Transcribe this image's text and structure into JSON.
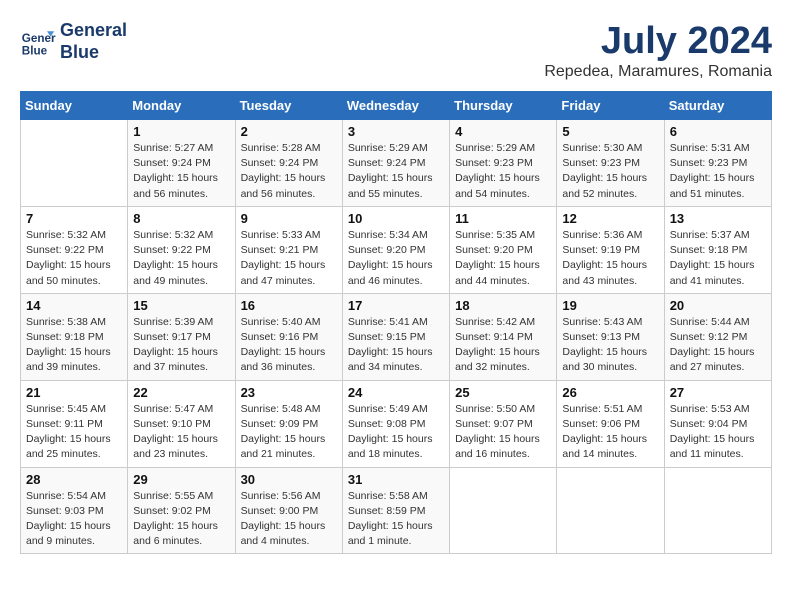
{
  "logo": {
    "line1": "General",
    "line2": "Blue"
  },
  "title": "July 2024",
  "location": "Repedea, Maramures, Romania",
  "days_header": [
    "Sunday",
    "Monday",
    "Tuesday",
    "Wednesday",
    "Thursday",
    "Friday",
    "Saturday"
  ],
  "weeks": [
    [
      {
        "day": "",
        "info": ""
      },
      {
        "day": "1",
        "info": "Sunrise: 5:27 AM\nSunset: 9:24 PM\nDaylight: 15 hours\nand 56 minutes."
      },
      {
        "day": "2",
        "info": "Sunrise: 5:28 AM\nSunset: 9:24 PM\nDaylight: 15 hours\nand 56 minutes."
      },
      {
        "day": "3",
        "info": "Sunrise: 5:29 AM\nSunset: 9:24 PM\nDaylight: 15 hours\nand 55 minutes."
      },
      {
        "day": "4",
        "info": "Sunrise: 5:29 AM\nSunset: 9:23 PM\nDaylight: 15 hours\nand 54 minutes."
      },
      {
        "day": "5",
        "info": "Sunrise: 5:30 AM\nSunset: 9:23 PM\nDaylight: 15 hours\nand 52 minutes."
      },
      {
        "day": "6",
        "info": "Sunrise: 5:31 AM\nSunset: 9:23 PM\nDaylight: 15 hours\nand 51 minutes."
      }
    ],
    [
      {
        "day": "7",
        "info": "Sunrise: 5:32 AM\nSunset: 9:22 PM\nDaylight: 15 hours\nand 50 minutes."
      },
      {
        "day": "8",
        "info": "Sunrise: 5:32 AM\nSunset: 9:22 PM\nDaylight: 15 hours\nand 49 minutes."
      },
      {
        "day": "9",
        "info": "Sunrise: 5:33 AM\nSunset: 9:21 PM\nDaylight: 15 hours\nand 47 minutes."
      },
      {
        "day": "10",
        "info": "Sunrise: 5:34 AM\nSunset: 9:20 PM\nDaylight: 15 hours\nand 46 minutes."
      },
      {
        "day": "11",
        "info": "Sunrise: 5:35 AM\nSunset: 9:20 PM\nDaylight: 15 hours\nand 44 minutes."
      },
      {
        "day": "12",
        "info": "Sunrise: 5:36 AM\nSunset: 9:19 PM\nDaylight: 15 hours\nand 43 minutes."
      },
      {
        "day": "13",
        "info": "Sunrise: 5:37 AM\nSunset: 9:18 PM\nDaylight: 15 hours\nand 41 minutes."
      }
    ],
    [
      {
        "day": "14",
        "info": "Sunrise: 5:38 AM\nSunset: 9:18 PM\nDaylight: 15 hours\nand 39 minutes."
      },
      {
        "day": "15",
        "info": "Sunrise: 5:39 AM\nSunset: 9:17 PM\nDaylight: 15 hours\nand 37 minutes."
      },
      {
        "day": "16",
        "info": "Sunrise: 5:40 AM\nSunset: 9:16 PM\nDaylight: 15 hours\nand 36 minutes."
      },
      {
        "day": "17",
        "info": "Sunrise: 5:41 AM\nSunset: 9:15 PM\nDaylight: 15 hours\nand 34 minutes."
      },
      {
        "day": "18",
        "info": "Sunrise: 5:42 AM\nSunset: 9:14 PM\nDaylight: 15 hours\nand 32 minutes."
      },
      {
        "day": "19",
        "info": "Sunrise: 5:43 AM\nSunset: 9:13 PM\nDaylight: 15 hours\nand 30 minutes."
      },
      {
        "day": "20",
        "info": "Sunrise: 5:44 AM\nSunset: 9:12 PM\nDaylight: 15 hours\nand 27 minutes."
      }
    ],
    [
      {
        "day": "21",
        "info": "Sunrise: 5:45 AM\nSunset: 9:11 PM\nDaylight: 15 hours\nand 25 minutes."
      },
      {
        "day": "22",
        "info": "Sunrise: 5:47 AM\nSunset: 9:10 PM\nDaylight: 15 hours\nand 23 minutes."
      },
      {
        "day": "23",
        "info": "Sunrise: 5:48 AM\nSunset: 9:09 PM\nDaylight: 15 hours\nand 21 minutes."
      },
      {
        "day": "24",
        "info": "Sunrise: 5:49 AM\nSunset: 9:08 PM\nDaylight: 15 hours\nand 18 minutes."
      },
      {
        "day": "25",
        "info": "Sunrise: 5:50 AM\nSunset: 9:07 PM\nDaylight: 15 hours\nand 16 minutes."
      },
      {
        "day": "26",
        "info": "Sunrise: 5:51 AM\nSunset: 9:06 PM\nDaylight: 15 hours\nand 14 minutes."
      },
      {
        "day": "27",
        "info": "Sunrise: 5:53 AM\nSunset: 9:04 PM\nDaylight: 15 hours\nand 11 minutes."
      }
    ],
    [
      {
        "day": "28",
        "info": "Sunrise: 5:54 AM\nSunset: 9:03 PM\nDaylight: 15 hours\nand 9 minutes."
      },
      {
        "day": "29",
        "info": "Sunrise: 5:55 AM\nSunset: 9:02 PM\nDaylight: 15 hours\nand 6 minutes."
      },
      {
        "day": "30",
        "info": "Sunrise: 5:56 AM\nSunset: 9:00 PM\nDaylight: 15 hours\nand 4 minutes."
      },
      {
        "day": "31",
        "info": "Sunrise: 5:58 AM\nSunset: 8:59 PM\nDaylight: 15 hours\nand 1 minute."
      },
      {
        "day": "",
        "info": ""
      },
      {
        "day": "",
        "info": ""
      },
      {
        "day": "",
        "info": ""
      }
    ]
  ]
}
